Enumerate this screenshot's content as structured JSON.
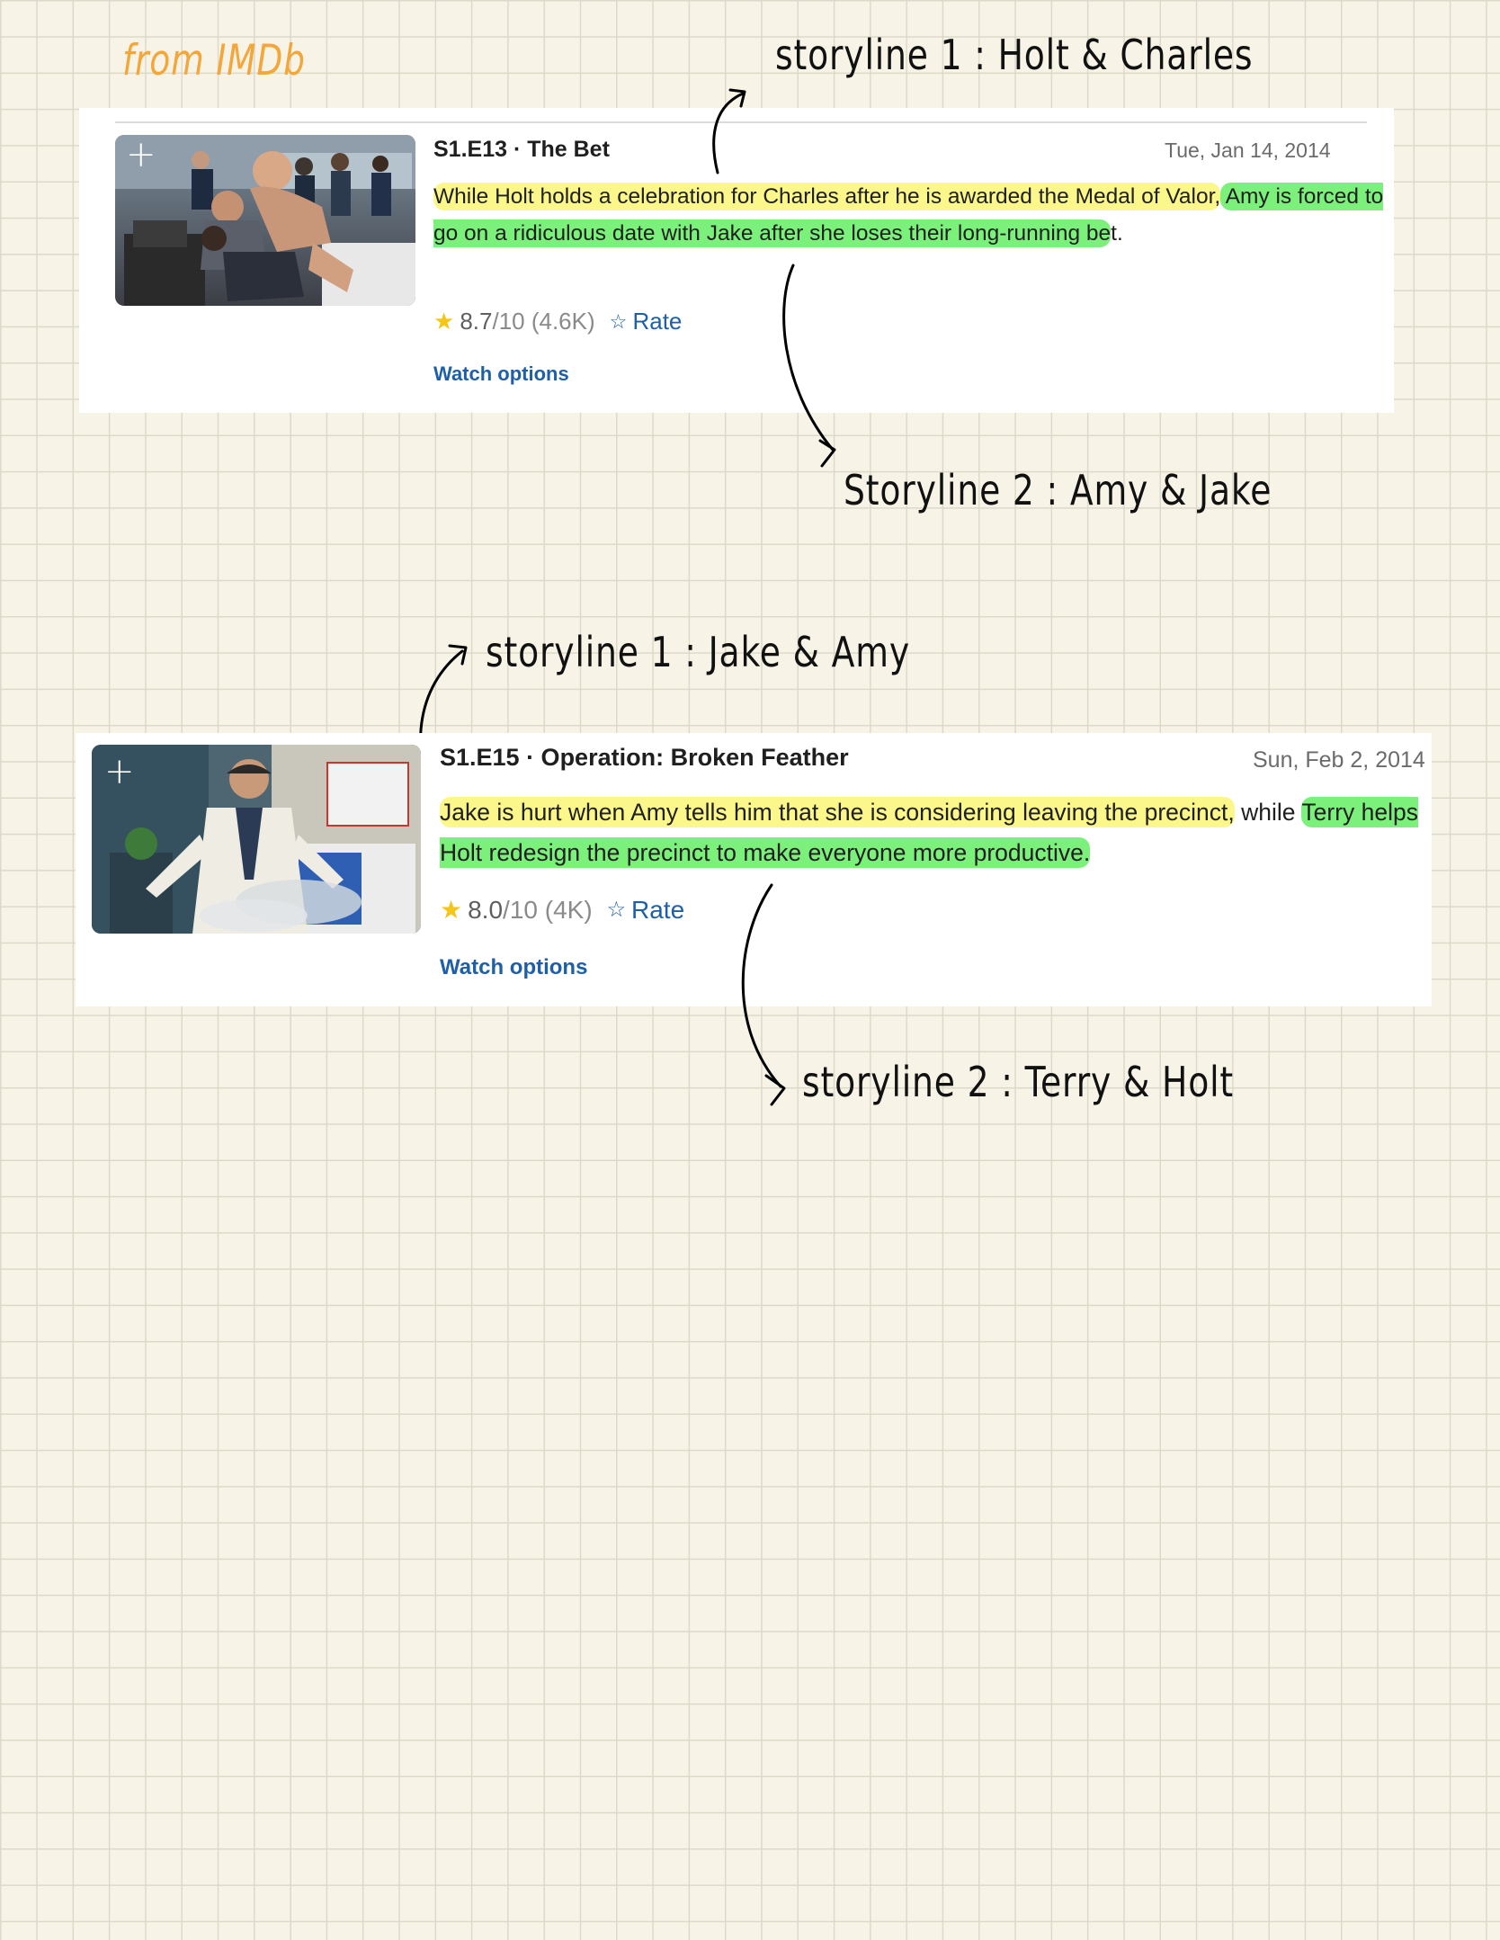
{
  "header_note": "from IMDb",
  "episodes": [
    {
      "title": "S1.E13 · The Bet",
      "date": "Tue, Jan 14, 2014",
      "synopsis_parts": [
        "While Holt holds a celebration for Charles after he is awarded the Medal of Valor,",
        " Amy is forced to go on a ridiculous date with Jake after she loses their long-running be",
        "t."
      ],
      "rating": "8.7",
      "rating_scale": "/10 (4.6K)",
      "rate_label": "Rate",
      "watch_label": "Watch options",
      "thumbnail_icon": "add-to-watchlist-plus-icon",
      "annotations": {
        "storyline_1": "storyline 1 : Holt & Charles",
        "storyline_2": "Storyline 2 : Amy & Jake"
      }
    },
    {
      "title": "S1.E15 · Operation: Broken Feather",
      "date": "Sun, Feb 2, 2014",
      "synopsis_parts": [
        "Jake is hurt when Amy tells him that she is considering leaving the precinct,",
        " while ",
        "Terry helps Holt redesign the precinct to make everyone more productive."
      ],
      "rating": "8.0",
      "rating_scale": "/10 (4K)",
      "rate_label": "Rate",
      "watch_label": "Watch options",
      "thumbnail_icon": "add-to-watchlist-plus-icon",
      "annotations": {
        "storyline_1": "storyline 1 : Jake & Amy",
        "storyline_2": "storyline 2 : Terry & Holt"
      }
    }
  ],
  "colors": {
    "paper": "#f7f4e7",
    "grid_line": "#ddd9c9",
    "header_note": "#f3a63a",
    "highlight_storyline_1": "#fbf78a",
    "highlight_storyline_2": "#7bf07b",
    "link": "#1f5fa8",
    "star": "#f5c518"
  }
}
